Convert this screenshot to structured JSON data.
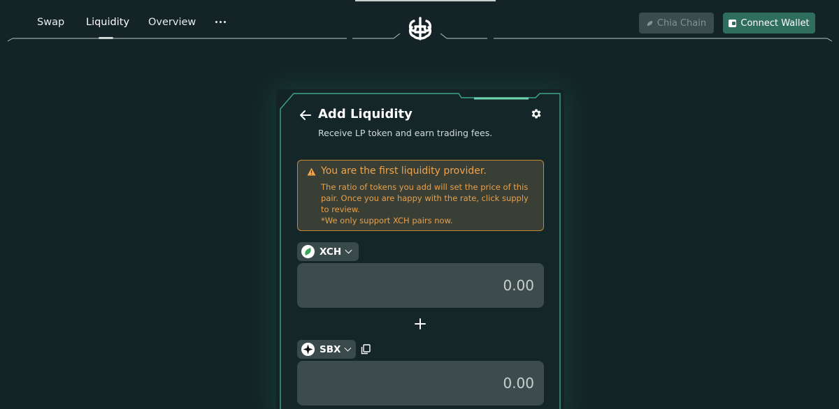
{
  "nav": {
    "items": [
      {
        "label": "Swap"
      },
      {
        "label": "Liquidity",
        "active": true
      },
      {
        "label": "Overview"
      }
    ],
    "more_icon": "more-horizontal-icon"
  },
  "header": {
    "logo_icon": "tibetswap-logo-icon",
    "chain_button": {
      "label": "Chia Chain",
      "icon": "chia-leaf-icon"
    },
    "wallet_button": {
      "label": "Connect Wallet",
      "icon": "wallet-icon"
    }
  },
  "card": {
    "title": "Add Liquidity",
    "subtitle": "Receive LP token and earn trading fees.",
    "back_icon": "arrow-left-icon",
    "settings_icon": "gear-icon",
    "warning": {
      "icon": "warning-triangle-icon",
      "title": "You are the first liquidity provider.",
      "lines": [
        "The ratio of tokens you add will set the price of this",
        "pair. Once you are happy with the rate, click supply",
        "to review.",
        "*We only support XCH pairs now."
      ]
    },
    "token_a": {
      "symbol": "XCH",
      "amount_placeholder": "0.00"
    },
    "plus_icon": "plus-icon",
    "token_b": {
      "symbol": "SBX",
      "amount_placeholder": "0.00",
      "copy_icon": "copy-icon"
    }
  },
  "colors": {
    "background": "#132326",
    "accent": "#2f6e5d",
    "frame": "#3aa88a",
    "warning": "#f0a44b"
  }
}
